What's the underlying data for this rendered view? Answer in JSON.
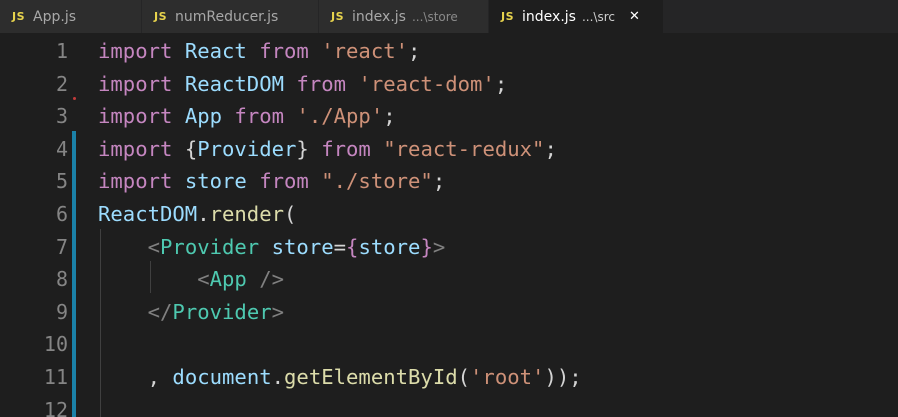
{
  "tabs": [
    {
      "icon": "JS",
      "label": "App.js",
      "desc": "",
      "active": false
    },
    {
      "icon": "JS",
      "label": "numReducer.js",
      "desc": "",
      "active": false
    },
    {
      "icon": "JS",
      "label": "index.js",
      "desc": "...\\store",
      "active": false
    },
    {
      "icon": "JS",
      "label": "index.js",
      "desc": "...\\src",
      "active": true,
      "close": "✕"
    }
  ],
  "colors": {
    "keyword": "#c586c0",
    "variable": "#9cdcfe",
    "string": "#ce9178",
    "function": "#dcdcaa",
    "component": "#4ec9b0",
    "punctuation": "#d4d4d4",
    "tag_bracket": "#808080",
    "line_number": "#858585",
    "modified_bar": "#1b81a8"
  },
  "lines": [
    {
      "number": "1",
      "tokens": [
        [
          "import",
          "kw"
        ],
        [
          " "
        ],
        [
          "React",
          "var"
        ],
        [
          " "
        ],
        [
          "from",
          "kw"
        ],
        [
          " "
        ],
        [
          "'react'",
          "str"
        ],
        [
          ";",
          "pun"
        ]
      ]
    },
    {
      "number": "2",
      "tokens": [
        [
          "import",
          "kw"
        ],
        [
          " "
        ],
        [
          "ReactDOM",
          "var"
        ],
        [
          " "
        ],
        [
          "from",
          "kw"
        ],
        [
          " "
        ],
        [
          "'react-dom'",
          "str"
        ],
        [
          ";",
          "pun"
        ]
      ]
    },
    {
      "number": "3",
      "tokens": [
        [
          "import",
          "kw"
        ],
        [
          " "
        ],
        [
          "App",
          "var"
        ],
        [
          " "
        ],
        [
          "from",
          "kw"
        ],
        [
          " "
        ],
        [
          "'./App'",
          "str"
        ],
        [
          ";",
          "pun"
        ]
      ]
    },
    {
      "number": "4",
      "tokens": [
        [
          "import",
          "kw"
        ],
        [
          " "
        ],
        [
          "{",
          "pun"
        ],
        [
          "Provider",
          "var"
        ],
        [
          "}",
          "pun"
        ],
        [
          " "
        ],
        [
          "from",
          "kw"
        ],
        [
          " "
        ],
        [
          "\"react-redux\"",
          "str"
        ],
        [
          ";",
          "pun"
        ]
      ]
    },
    {
      "number": "5",
      "tokens": [
        [
          "import",
          "kw"
        ],
        [
          " "
        ],
        [
          "store",
          "var"
        ],
        [
          " "
        ],
        [
          "from",
          "kw"
        ],
        [
          " "
        ],
        [
          "\"./store\"",
          "str"
        ],
        [
          ";",
          "pun"
        ]
      ]
    },
    {
      "number": "6",
      "tokens": [
        [
          "ReactDOM",
          "var"
        ],
        [
          ".",
          "pun"
        ],
        [
          "render",
          "fn"
        ],
        [
          "(",
          "pun"
        ]
      ]
    },
    {
      "number": "7",
      "tokens": [
        [
          "    "
        ],
        [
          "<",
          "tag"
        ],
        [
          "Provider",
          "cmp"
        ],
        [
          " "
        ],
        [
          "store",
          "var"
        ],
        [
          "=",
          "pun"
        ],
        [
          "{",
          "kw"
        ],
        [
          "store",
          "var"
        ],
        [
          "}",
          "kw"
        ],
        [
          ">",
          "tag"
        ]
      ]
    },
    {
      "number": "8",
      "tokens": [
        [
          "        "
        ],
        [
          "<",
          "tag"
        ],
        [
          "App",
          "cmp"
        ],
        [
          " "
        ],
        [
          "/>",
          "tag"
        ]
      ]
    },
    {
      "number": "9",
      "tokens": [
        [
          "    "
        ],
        [
          "</",
          "tag"
        ],
        [
          "Provider",
          "cmp"
        ],
        [
          ">",
          "tag"
        ]
      ]
    },
    {
      "number": "10",
      "tokens": []
    },
    {
      "number": "11",
      "tokens": [
        [
          "    "
        ],
        [
          ", ",
          "pun"
        ],
        [
          "document",
          "var"
        ],
        [
          ".",
          "pun"
        ],
        [
          "getElementById",
          "fn"
        ],
        [
          "(",
          "pun"
        ],
        [
          "'root'",
          "str"
        ],
        [
          "));",
          "pun"
        ]
      ]
    },
    {
      "number": "12",
      "tokens": []
    }
  ]
}
